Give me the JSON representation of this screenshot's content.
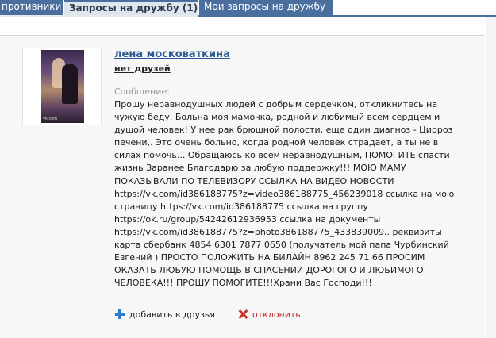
{
  "tabs": {
    "items": [
      {
        "label": "противники"
      },
      {
        "label": "Запросы на дружбу (1)"
      },
      {
        "label": "Мои запросы на дружбу"
      }
    ]
  },
  "request": {
    "name": "лена москов­аткина",
    "friends_status": "нет друзей",
    "message_label": "Сообщение:",
    "message": "Прошу неравнодушных людей с добрым сердечком, откликнитесь на чужую беду. Больна моя мамочка, родной и любимый всем сердцем и душой человек! У нее рак брюшной полости, еще один диагноз - Цирроз печени,. Это очень больно, когда родной человек страдает, а ты не в силах помочь... Обращаюсь ко всем неравнодушным, ПОМОГИТЕ спасти жизнь Заранее Благодарю за любую поддержку!!! МОЮ МАМУ ПОКАЗЫВАЛИ ПО ТЕЛЕВИЗОРУ ССЫЛКА НА ВИДЕО НОВОСТИ https://vk.com/id386188775?z=video386188775_456239018 ссылка на мою страницу https://vk.com/id386188775 ссылка на группу https://ok.ru/group/54242612936953 ссылка на документы https://vk.com/id386188775?z=photo386188775_433839009.. реквизиты карта сбербанк 4854 6301 7877 0650 (получатель мой папа Чурбинский Евгений ) ПРОСТО ПОЛОЖИТЬ НА БИЛАЙН 8962 245 71 66 ПРОСИМ ОКАЗАТЬ ЛЮБУЮ ПОМОЩЬ В СПАСЕНИИ ДОРОГОГО И ЛЮБИМОГО ЧЕЛОВЕКА!!! ПРОШУ ПОМОГИТЕ!!!Храни Вас Господи!!!",
    "photo_caption": "vk.com",
    "add_label": "добавить в друзья",
    "decline_label": "отклонить"
  },
  "colors": {
    "accent": "#4a6f9f",
    "link": "#2b5a92",
    "decline": "#c0302b",
    "add_icon": "#2a7bd0"
  },
  "icons": {
    "add": "plus-icon",
    "decline": "cross-icon"
  }
}
